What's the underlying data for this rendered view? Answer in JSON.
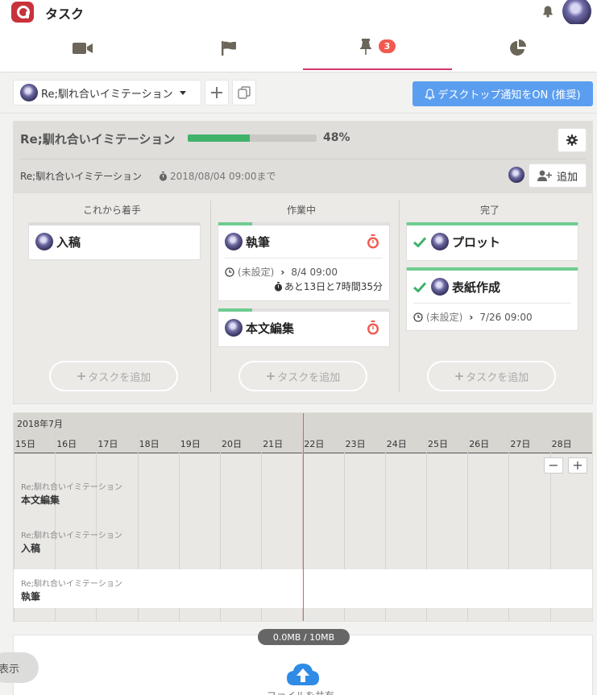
{
  "app": {
    "title": "タスク"
  },
  "nav": {
    "tabs": [
      {
        "id": "video",
        "icon": "video-icon"
      },
      {
        "id": "flag",
        "icon": "flag-icon"
      },
      {
        "id": "pin",
        "icon": "pin-icon",
        "badge": "3",
        "active": true
      },
      {
        "id": "chart",
        "icon": "pie-chart-icon"
      }
    ],
    "active_color": "#d6336c"
  },
  "toolbar": {
    "project_select": "Re;馴れ合いイミテーション",
    "notify_button": "デスクトップ通知をON (推奨)"
  },
  "project": {
    "title": "Re;馴れ合いイミテーション",
    "progress": 48,
    "progress_label": "48%",
    "subtitle": "Re;馴れ合いイミテーション",
    "deadline": "2018/08/04 09:00まで",
    "add_member_label": "追加"
  },
  "board": {
    "add_task_label": "タスクを追加",
    "columns": [
      {
        "title": "これから着手",
        "cards": [
          {
            "name": "入稿"
          }
        ]
      },
      {
        "title": "作業中",
        "cards": [
          {
            "name": "執筆",
            "start": "(未設定)",
            "due": "8/4 09:00",
            "remaining": "あと13日と7時間35分"
          },
          {
            "name": "本文編集"
          }
        ]
      },
      {
        "title": "完了",
        "cards": [
          {
            "name": "プロット"
          },
          {
            "name": "表紙作成",
            "start": "(未設定)",
            "due": "7/26 09:00"
          }
        ]
      }
    ]
  },
  "timeline": {
    "month": "2018年7月",
    "days": [
      "15日",
      "16日",
      "17日",
      "18日",
      "19日",
      "20日",
      "21日",
      "22日",
      "23日",
      "24日",
      "25日",
      "26日",
      "27日",
      "28日"
    ],
    "today": "22日",
    "rows": [
      {
        "project": "Re;馴れ合いイミテーション",
        "task": "本文編集"
      },
      {
        "project": "Re;馴れ合いイミテーション",
        "task": "入稿"
      },
      {
        "project": "Re;馴れ合いイミテーション",
        "task": "執筆"
      }
    ],
    "zoom_out": "−",
    "zoom_in": "+"
  },
  "upload": {
    "storage": "0.0MB / 10MB",
    "label": "ファイルを共有",
    "show_button": "表示"
  },
  "colors": {
    "accent_blue": "#5b9ef0",
    "progress_green": "#40b26a",
    "timer_red": "#f05a50",
    "today_line": "#e0634e"
  }
}
